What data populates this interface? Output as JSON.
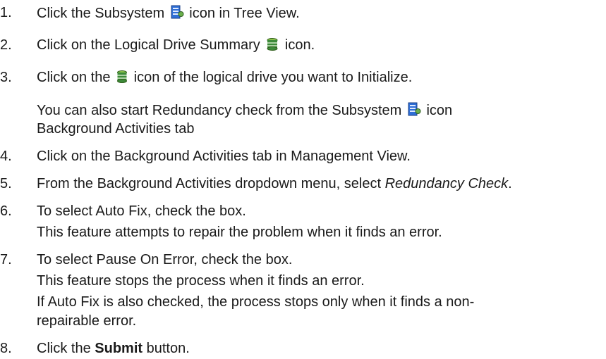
{
  "steps": [
    {
      "number": "1.",
      "pre": "Click the Subsystem",
      "post": "icon in Tree View.",
      "icon": "subsystem-icon"
    },
    {
      "number": "2.",
      "pre": "Click on the Logical Drive Summary",
      "post": "icon.",
      "icon": "logical-drive-summary-icon"
    },
    {
      "number": "3.",
      "pre": "Click on the",
      "post": "icon of the logical drive you want to Initialize.",
      "icon": "logical-drive-icon"
    },
    {
      "number": "4.",
      "text": "Click on the Background Activities tab in Management View."
    },
    {
      "number": "5.",
      "pre": "From the Background Activities dropdown menu, select",
      "emphasis": "Redundancy Check",
      "post": "."
    },
    {
      "number": "6.",
      "text": "To select Auto Fix, check the box."
    },
    {
      "number": "7.",
      "text": "To select Pause On Error, check the box."
    },
    {
      "number": "8.",
      "pre": "Click the",
      "emphasis": "Submit",
      "post": "button."
    }
  ],
  "notes": {
    "step3_line1_pre": "You can also start Redundancy check from the Subsystem",
    "step3_line1_post": "icon",
    "step3_line2": "Background Activities tab",
    "step6": "This feature attempts to repair the problem when it finds an error.",
    "step7_a": "This feature stops the process when it finds an error.",
    "step7_b_line1": "If Auto Fix is also checked, the process stops only when it finds a non-",
    "step7_b_line2": "repairable error."
  },
  "colors": {
    "text": "#1a1a1a",
    "subsystem_icon_blue": "#2f6fd6",
    "drive_icon_green": "#3d8a3a"
  }
}
